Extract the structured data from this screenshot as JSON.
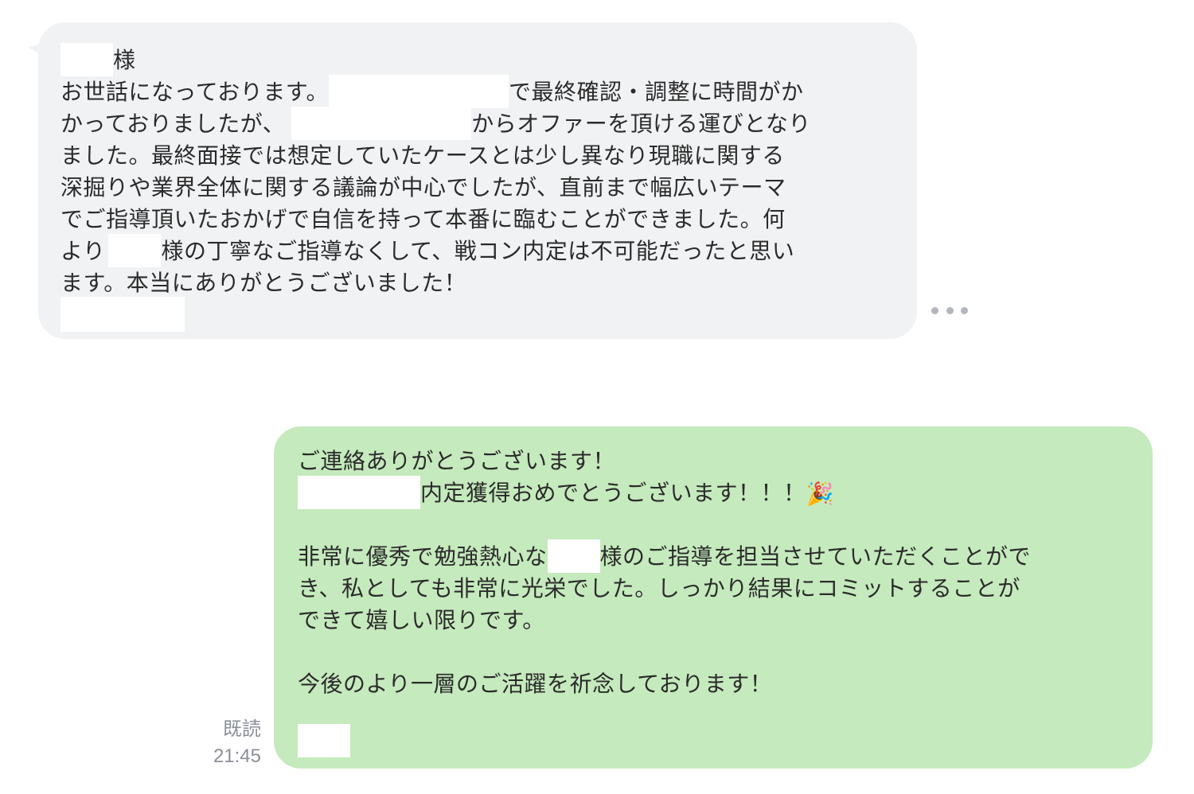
{
  "incoming_message": {
    "lines": [
      "様",
      "お世話になっております。",
      "で最終確認・調整に時間がか",
      "かっておりましたが、",
      "からオファーを頂ける運びとなり",
      "ました。最終面接では想定していたケースとは少し異なり現職に関する",
      "深掘りや業界全体に関する議論が中心でしたが、直前まで幅広いテーマ",
      "でご指導頂いたおかげで自信を持って本番に臨むことができました。何",
      "より",
      "様の丁寧なご指導なくして、戦コン内定は不可能だったと思い",
      "ます。本当にありがとうございました！"
    ]
  },
  "more_button": {
    "icon": "more-horizontal-icon"
  },
  "outgoing_message": {
    "lines": [
      "ご連絡ありがとうございます！",
      "内定獲得おめでとうございます！！！",
      "非常に優秀で勉強熱心な",
      "様のご指導を担当させていただくことがで",
      "き、私としても非常に光栄でした。しっかり結果にコミットすることが",
      "できて嬉しい限りです。",
      "今後のより一層のご活躍を祈念しております！"
    ],
    "emoji": "🎉",
    "background": "#c5eabd"
  },
  "read_status": {
    "label": "既読",
    "time": "21:45"
  }
}
